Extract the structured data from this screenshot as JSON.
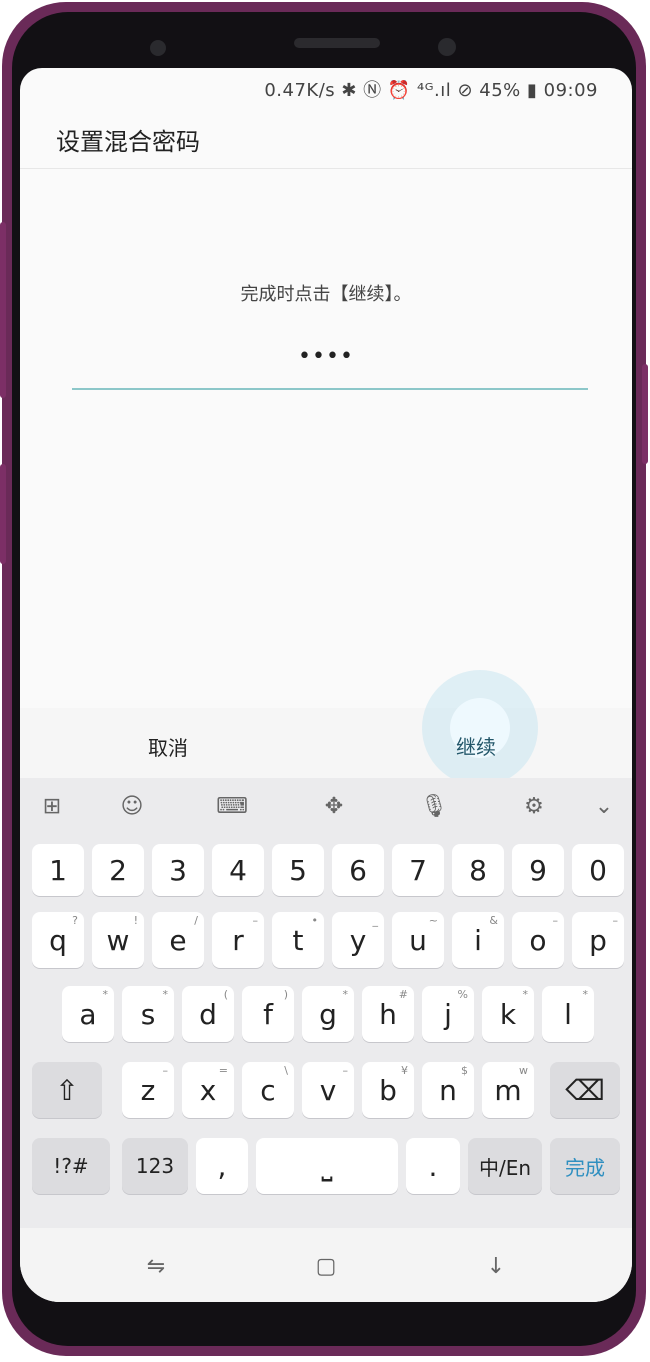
{
  "status": {
    "text": "0.47K/s ✱ Ⓝ ⏰ ⁴ᴳ.ıl ⊘ 45% ▮ 09:09"
  },
  "page": {
    "title": "设置混合密码",
    "prompt": "完成时点击【继续】。",
    "password_mask": "••••"
  },
  "actions": {
    "cancel": "取消",
    "continue": "继续"
  },
  "toolbar": {
    "items": [
      {
        "name": "sticker-icon",
        "glyph": "⊞"
      },
      {
        "name": "emoji-icon",
        "glyph": "☺"
      },
      {
        "name": "keyboard-icon",
        "glyph": "⌨"
      },
      {
        "name": "move-icon",
        "glyph": "✥"
      },
      {
        "name": "microphone-icon",
        "glyph": "🎙"
      },
      {
        "name": "settings-icon",
        "glyph": "⚙"
      },
      {
        "name": "chevron-down-icon",
        "glyph": "⌄"
      }
    ]
  },
  "keyboard": {
    "row_numbers": [
      "1",
      "2",
      "3",
      "4",
      "5",
      "6",
      "7",
      "8",
      "9",
      "0"
    ],
    "row_q": [
      {
        "k": "q",
        "s": "?"
      },
      {
        "k": "w",
        "s": "!"
      },
      {
        "k": "e",
        "s": "/"
      },
      {
        "k": "r",
        "s": "–"
      },
      {
        "k": "t",
        "s": "•"
      },
      {
        "k": "y",
        "s": "_"
      },
      {
        "k": "u",
        "s": "~"
      },
      {
        "k": "i",
        "s": "&"
      },
      {
        "k": "o",
        "s": "–"
      },
      {
        "k": "p",
        "s": "–"
      }
    ],
    "row_a": [
      {
        "k": "a",
        "s": "*"
      },
      {
        "k": "s",
        "s": "*"
      },
      {
        "k": "d",
        "s": "("
      },
      {
        "k": "f",
        "s": ")"
      },
      {
        "k": "g",
        "s": "*"
      },
      {
        "k": "h",
        "s": "#"
      },
      {
        "k": "j",
        "s": "%"
      },
      {
        "k": "k",
        "s": "*"
      },
      {
        "k": "l",
        "s": "*"
      }
    ],
    "row_z": [
      {
        "k": "z",
        "s": "–"
      },
      {
        "k": "x",
        "s": "="
      },
      {
        "k": "c",
        "s": "\\"
      },
      {
        "k": "v",
        "s": "–"
      },
      {
        "k": "b",
        "s": "¥"
      },
      {
        "k": "n",
        "s": "$"
      },
      {
        "k": "m",
        "s": "w"
      }
    ],
    "shift": "⇧",
    "backspace": "⌫",
    "sym": "!?#",
    "num": "123",
    "comma": ",",
    "space": "⎵",
    "period": ".",
    "lang": "中/En",
    "done": "完成"
  },
  "navbar": {
    "recent": "⇋",
    "home": "▢",
    "back": "↓"
  }
}
